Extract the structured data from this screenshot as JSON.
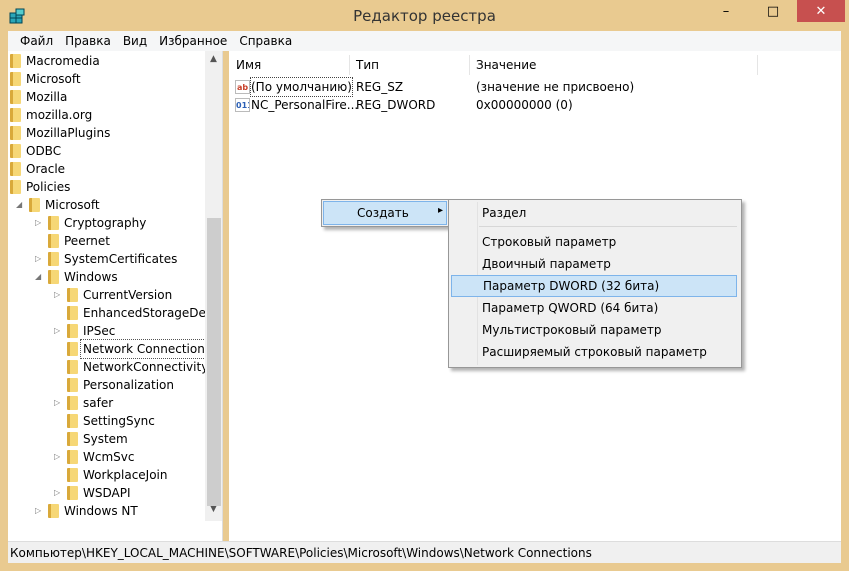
{
  "window": {
    "title": "Редактор реестра",
    "minimize": "–",
    "maximize": "□",
    "close": "✕"
  },
  "menu": [
    "Файл",
    "Правка",
    "Вид",
    "Избранное",
    "Справка"
  ],
  "tree": [
    {
      "label": "Macromedia",
      "level": 0,
      "exp": ""
    },
    {
      "label": "Microsoft",
      "level": 0,
      "exp": ""
    },
    {
      "label": "Mozilla",
      "level": 0,
      "exp": ""
    },
    {
      "label": "mozilla.org",
      "level": 0,
      "exp": ""
    },
    {
      "label": "MozillaPlugins",
      "level": 0,
      "exp": ""
    },
    {
      "label": "ODBC",
      "level": 0,
      "exp": ""
    },
    {
      "label": "Oracle",
      "level": 0,
      "exp": ""
    },
    {
      "label": "Policies",
      "level": 0,
      "exp": ""
    },
    {
      "label": "Microsoft",
      "level": 1,
      "exp": "◢"
    },
    {
      "label": "Cryptography",
      "level": 2,
      "exp": "▷"
    },
    {
      "label": "Peernet",
      "level": 2,
      "exp": ""
    },
    {
      "label": "SystemCertificates",
      "level": 2,
      "exp": "▷"
    },
    {
      "label": "Windows",
      "level": 2,
      "exp": "◢"
    },
    {
      "label": "CurrentVersion",
      "level": 3,
      "exp": "▷"
    },
    {
      "label": "EnhancedStorageDevices",
      "level": 3,
      "exp": ""
    },
    {
      "label": "IPSec",
      "level": 3,
      "exp": "▷"
    },
    {
      "label": "Network Connections",
      "level": 3,
      "exp": "",
      "selected": true
    },
    {
      "label": "NetworkConnectivityStatusIndicator",
      "level": 3,
      "exp": ""
    },
    {
      "label": "Personalization",
      "level": 3,
      "exp": ""
    },
    {
      "label": "safer",
      "level": 3,
      "exp": "▷"
    },
    {
      "label": "SettingSync",
      "level": 3,
      "exp": ""
    },
    {
      "label": "System",
      "level": 3,
      "exp": ""
    },
    {
      "label": "WcmSvc",
      "level": 3,
      "exp": "▷"
    },
    {
      "label": "WorkplaceJoin",
      "level": 3,
      "exp": ""
    },
    {
      "label": "WSDAPI",
      "level": 3,
      "exp": "▷"
    },
    {
      "label": "Windows NT",
      "level": 2,
      "exp": "▷"
    }
  ],
  "list": {
    "columns": [
      "Имя",
      "Тип",
      "Значение"
    ],
    "rows": [
      {
        "icon": "string-value-icon",
        "glyph": "ab",
        "name": "(По умолчанию)",
        "type": "REG_SZ",
        "value": "(значение не присвоено)"
      },
      {
        "icon": "binary-value-icon",
        "glyph": "011",
        "name": "NC_PersonalFire...",
        "type": "REG_DWORD",
        "value": "0x00000000 (0)"
      }
    ]
  },
  "context_menu": {
    "item": "Создать",
    "arrow": "▸"
  },
  "submenu": [
    "Раздел",
    "Строковый параметр",
    "Двоичный параметр",
    "Параметр DWORD (32 бита)",
    "Параметр QWORD (64 бита)",
    "Мультистроковый параметр",
    "Расширяемый строковый параметр"
  ],
  "submenu_highlighted": "Параметр DWORD (32 бита)",
  "status": "Компьютер\\HKEY_LOCAL_MACHINE\\SOFTWARE\\Policies\\Microsoft\\Windows\\Network Connections",
  "colors": {
    "frame": "#e9ca90",
    "close": "#c7504f",
    "highlight": "#cce4f7"
  }
}
